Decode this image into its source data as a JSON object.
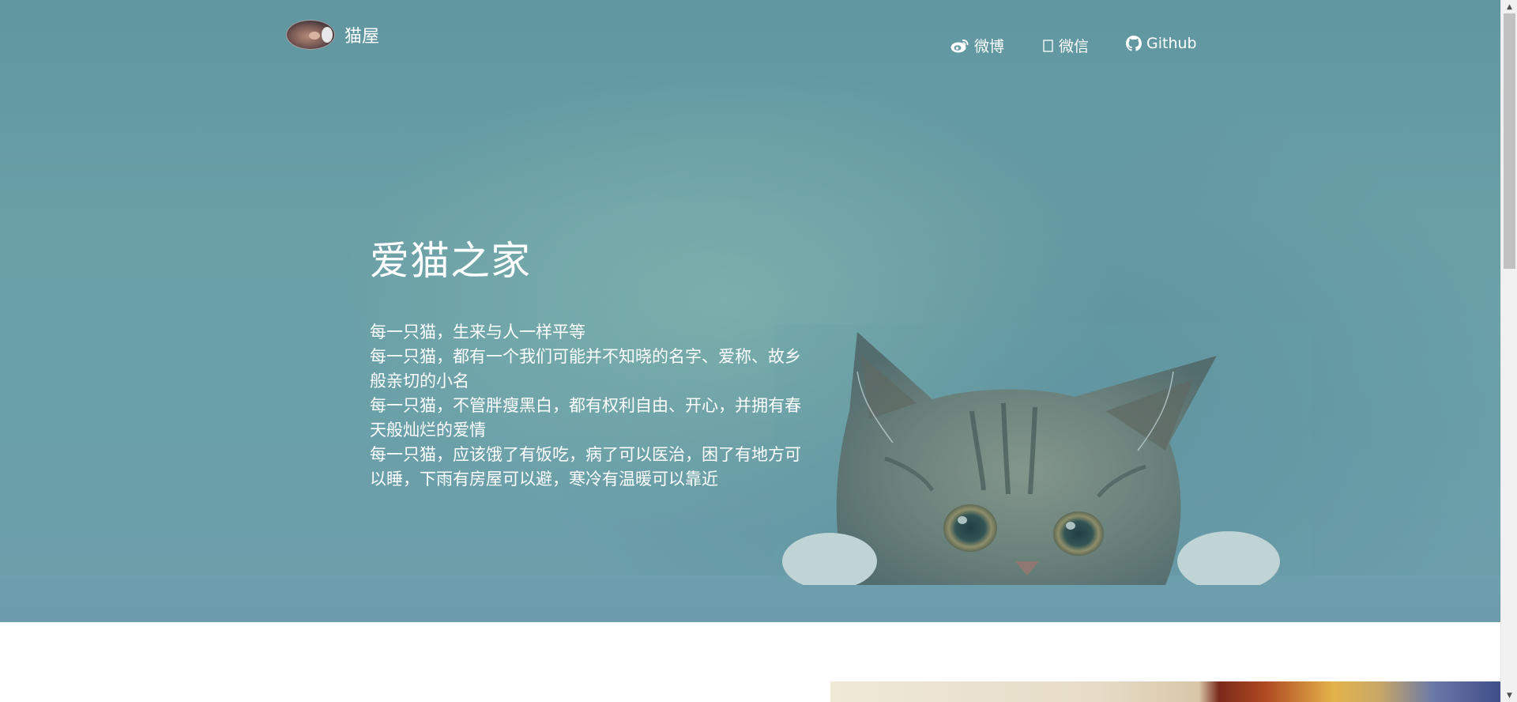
{
  "brand": {
    "name": "猫屋",
    "avatar_icon": "cat-avatar-icon"
  },
  "nav": {
    "items": [
      {
        "label": "微博",
        "icon": "weibo-icon"
      },
      {
        "label": "微信",
        "icon": "wechat-icon"
      },
      {
        "label": "Github",
        "icon": "github-icon"
      }
    ]
  },
  "hero": {
    "title": "爱猫之家",
    "lines": [
      "每一只猫，生来与人一样平等",
      "每一只猫，都有一个我们可能并不知晓的名字、爱称、故乡般亲切的小名",
      "每一只猫，不管胖瘦黑白，都有权利自由、开心，并拥有春天般灿烂的爱情",
      "每一只猫，应该饿了有饭吃，病了可以医治，困了有地方可以睡，下雨有房屋可以避，寒冷有温暖可以靠近"
    ]
  },
  "colors": {
    "hero_background": "#6aa0a8",
    "text": "#ffffff"
  }
}
